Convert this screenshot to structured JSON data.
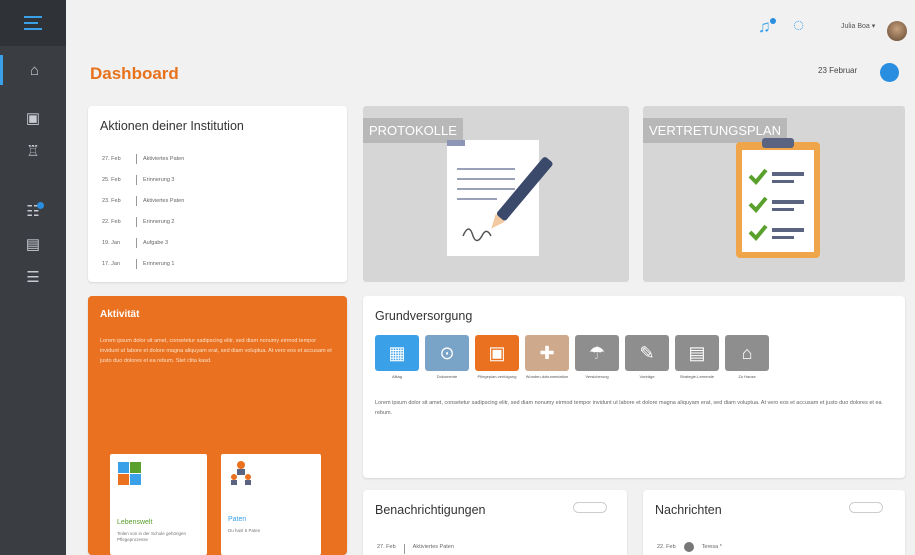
{
  "header": {
    "user_name": "Julia Boa ▾"
  },
  "page": {
    "title": "Dashboard",
    "date": "23 Februar"
  },
  "actions": {
    "title": "Aktionen deiner Institution",
    "items": [
      {
        "date": "27. Feb",
        "label": "Aktiviertes Paten"
      },
      {
        "date": "25. Feb",
        "label": "Erinnerung 3"
      },
      {
        "date": "23. Feb",
        "label": "Aktiviertes Paten"
      },
      {
        "date": "22. Feb",
        "label": "Erinnerung 2"
      },
      {
        "date": "19. Jan",
        "label": "Aufgabe 3"
      },
      {
        "date": "17. Jan",
        "label": "Erinnerung 1"
      }
    ]
  },
  "tiles": {
    "protokolle": "PROTOKOLLE",
    "vertretungsplan": "VERTRETUNGSPLAN"
  },
  "activity": {
    "title": "Aktivität",
    "text": "Lorem ipsum dolor sit amet, consetetur sadipscing elitr, sed diam nonumy eirmod tempor invidunt ut labore et dolore magna aliquyam erat, sed diam voluptua. At vero eos et accusam et justo duo dolores et ea rebum. Stet clita kasd.",
    "cards": [
      {
        "label": "Lebenswelt",
        "desc": "Teilen von in der Schule gehörigen Pflegeprozesse",
        "color": "#5aa02c"
      },
      {
        "label": "Paten",
        "desc": "Du hast 5 Paten",
        "color": "#3aa0e8"
      }
    ]
  },
  "grundversorgung": {
    "title": "Grundversorgung",
    "items": [
      {
        "label": "Alltag",
        "color": "#3aa0e8",
        "glyph": "▦"
      },
      {
        "label": "Dokumente",
        "color": "#7aa3c8",
        "glyph": "⊙"
      },
      {
        "label": "Pflegeplan-verfolgung",
        "color": "#e9711f",
        "glyph": "▣"
      },
      {
        "label": "Wunden-dokumentation",
        "color": "#cfa98c",
        "glyph": "✚"
      },
      {
        "label": "Versicherung",
        "color": "#8e8e8e",
        "glyph": "☂"
      },
      {
        "label": "Vorträge",
        "color": "#8e8e8e",
        "glyph": "✎"
      },
      {
        "label": "Strategie-Lernende",
        "color": "#8e8e8e",
        "glyph": "▤"
      },
      {
        "label": "Zu Hause",
        "color": "#8e8e8e",
        "glyph": "⌂"
      }
    ],
    "text": "Lorem ipsum dolor sit amet, consetetur sadipscing elitr, sed diam nonumy eirmod tempor invidunt ut labore et dolore magna aliquyam erat, sed diam voluptua. At vero eos et accusam et justo duo dolores et ea rebum."
  },
  "notifications": {
    "title": "Benachrichtigungen",
    "item_date": "27. Feb",
    "item_label": "Aktiviertes Paten"
  },
  "messages": {
    "title": "Nachrichten",
    "item_date": "22. Feb",
    "item_label": "Teresa *"
  }
}
